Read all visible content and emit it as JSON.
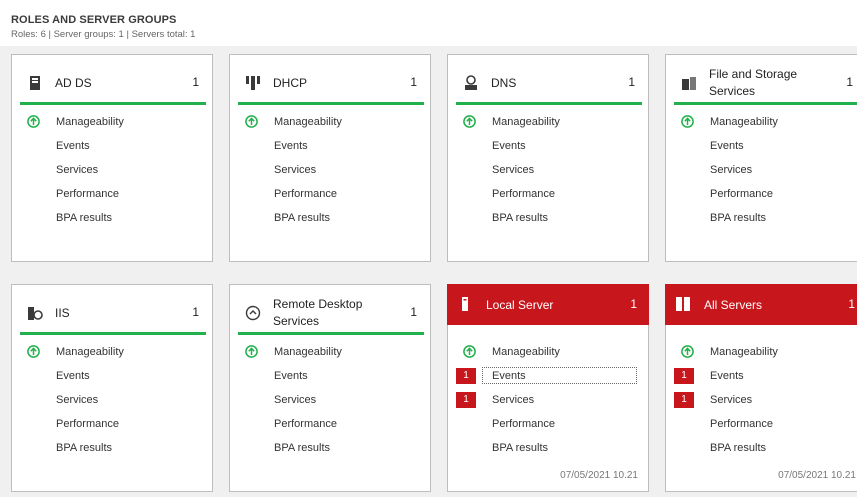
{
  "header": {
    "title": "ROLES AND SERVER GROUPS",
    "summary": "Roles: 6  |  Server groups: 1  |  Servers total: 1"
  },
  "colors": {
    "ok_green": "#22b14c",
    "alert_red": "#c8161d"
  },
  "tiles": [
    {
      "name": "AD DS",
      "count": "1",
      "icon": "ad-ds-icon",
      "alert": false,
      "rows": [
        {
          "label": "Manageability",
          "status": "ok"
        },
        {
          "label": "Events"
        },
        {
          "label": "Services"
        },
        {
          "label": "Performance"
        },
        {
          "label": "BPA results"
        }
      ]
    },
    {
      "name": "DHCP",
      "count": "1",
      "icon": "dhcp-icon",
      "alert": false,
      "rows": [
        {
          "label": "Manageability",
          "status": "ok"
        },
        {
          "label": "Events"
        },
        {
          "label": "Services"
        },
        {
          "label": "Performance"
        },
        {
          "label": "BPA results"
        }
      ]
    },
    {
      "name": "DNS",
      "count": "1",
      "icon": "dns-icon",
      "alert": false,
      "rows": [
        {
          "label": "Manageability",
          "status": "ok"
        },
        {
          "label": "Events"
        },
        {
          "label": "Services"
        },
        {
          "label": "Performance"
        },
        {
          "label": "BPA results"
        }
      ]
    },
    {
      "name": "File and Storage Services",
      "count": "1",
      "icon": "file-storage-icon",
      "alert": false,
      "rows": [
        {
          "label": "Manageability",
          "status": "ok"
        },
        {
          "label": "Events"
        },
        {
          "label": "Services"
        },
        {
          "label": "Performance"
        },
        {
          "label": "BPA results"
        }
      ]
    },
    {
      "name": "IIS",
      "count": "1",
      "icon": "iis-icon",
      "alert": false,
      "rows": [
        {
          "label": "Manageability",
          "status": "ok"
        },
        {
          "label": "Events"
        },
        {
          "label": "Services"
        },
        {
          "label": "Performance"
        },
        {
          "label": "BPA results"
        }
      ]
    },
    {
      "name": "Remote Desktop Services",
      "count": "1",
      "icon": "remote-desktop-icon",
      "alert": false,
      "rows": [
        {
          "label": "Manageability",
          "status": "ok"
        },
        {
          "label": "Events"
        },
        {
          "label": "Services"
        },
        {
          "label": "Performance"
        },
        {
          "label": "BPA results"
        }
      ]
    },
    {
      "name": "Local Server",
      "count": "1",
      "icon": "server-icon",
      "alert": true,
      "timestamp": "07/05/2021 10.21",
      "rows": [
        {
          "label": "Manageability",
          "status": "ok"
        },
        {
          "label": "Events",
          "badge": "1",
          "focused": true
        },
        {
          "label": "Services",
          "badge": "1"
        },
        {
          "label": "Performance"
        },
        {
          "label": "BPA results"
        }
      ]
    },
    {
      "name": "All Servers",
      "count": "1",
      "icon": "servers-icon",
      "alert": true,
      "timestamp": "07/05/2021 10.21",
      "rows": [
        {
          "label": "Manageability",
          "status": "ok"
        },
        {
          "label": "Events",
          "badge": "1"
        },
        {
          "label": "Services",
          "badge": "1"
        },
        {
          "label": "Performance"
        },
        {
          "label": "BPA results"
        }
      ]
    }
  ]
}
